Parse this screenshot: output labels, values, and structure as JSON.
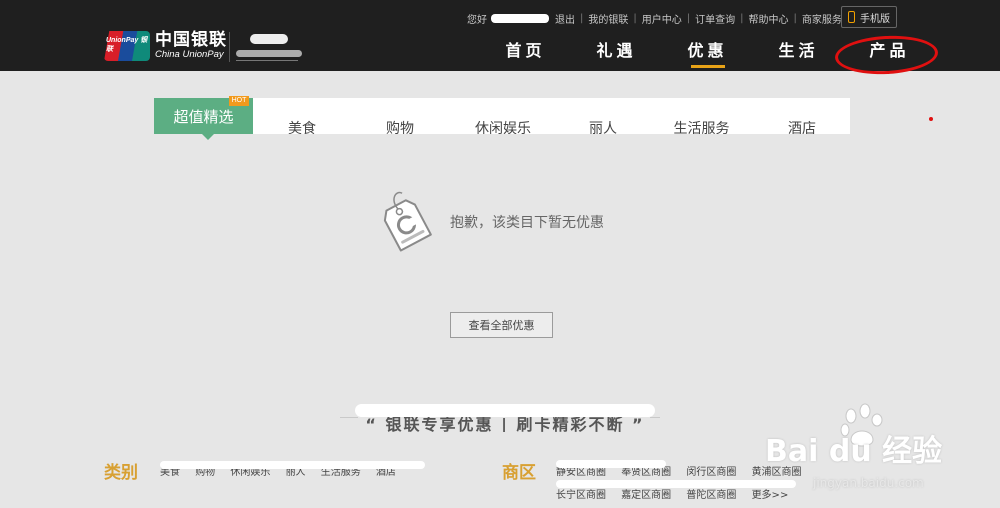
{
  "brand": {
    "name_cn": "中国银联",
    "name_en": "China UnionPay",
    "mark_text": "UnionPay 银联"
  },
  "toplinks": {
    "greeting": "您好",
    "items": [
      "退出",
      "我的银联",
      "用户中心",
      "订单查询",
      "帮助中心",
      "商家服务"
    ],
    "mobile_label": "手机版"
  },
  "nav": {
    "items": [
      "首页",
      "礼遇",
      "优惠",
      "生活",
      "产品"
    ],
    "active_index": 2
  },
  "categories": {
    "tabs": [
      "超值精选",
      "美食",
      "购物",
      "休闲娱乐",
      "丽人",
      "生活服务",
      "酒店"
    ],
    "hot_badge": "HOT",
    "active_index": 0
  },
  "empty_state": {
    "message": "抱歉，该类目下暂无优惠",
    "button_label": "查看全部优惠"
  },
  "section": {
    "title": "“ 银联专享优惠 | 刷卡精彩不断 ”"
  },
  "filters": {
    "category_label": "类别",
    "category_items": [
      "美食",
      "购物",
      "休闲娱乐",
      "丽人",
      "生活服务",
      "酒店"
    ],
    "district_label": "商区",
    "district_items_row1": [
      "静安区商圈",
      "奉贤区商圈",
      "闵行区商圈",
      "黄浦区商圈"
    ],
    "district_items_row2": [
      "长宁区商圈",
      "嘉定区商圈",
      "普陀区商圈",
      "更多>>"
    ]
  },
  "watermark": {
    "brand": "Bai du 经验",
    "url": "jingyan.baidu.com"
  },
  "colors": {
    "header_bg": "#1f1f1f",
    "hot_tab": "#5cae83",
    "accent": "#e8a317",
    "annotation": "#e01010"
  }
}
